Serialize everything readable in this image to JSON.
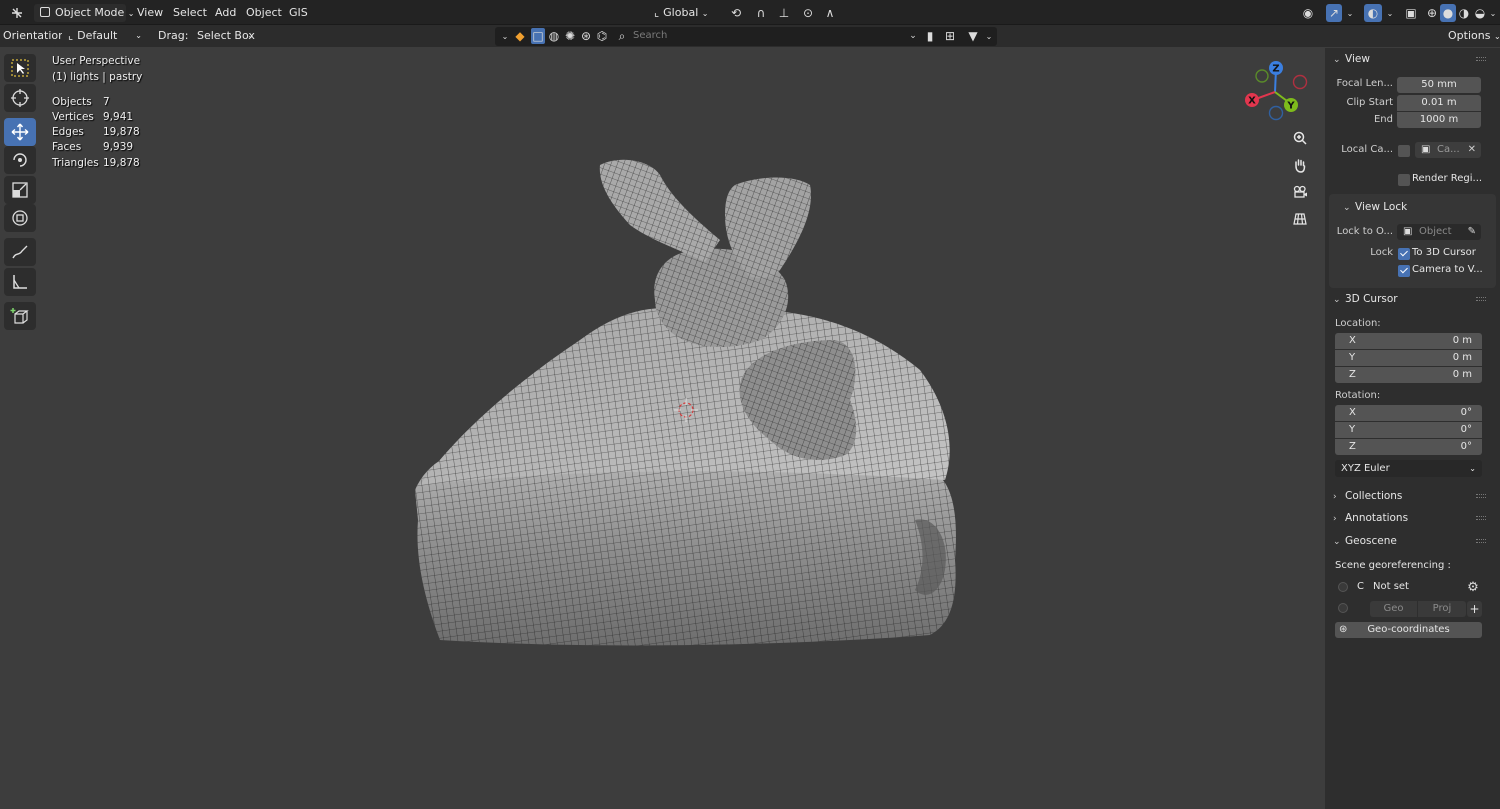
{
  "header": {
    "mode": "Object Mode",
    "menus": [
      "View",
      "Select",
      "Add",
      "Object",
      "GIS"
    ],
    "transform_orientation": "Global",
    "options_label": "Options"
  },
  "tool_settings": {
    "orientation_label": "Orientation:",
    "orientation_value": "Default",
    "drag_label": "Drag:",
    "drag_value": "Select Box",
    "search_placeholder": "Search"
  },
  "overlay": {
    "perspective": "User Perspective",
    "context": "(1) lights | pastry",
    "stats": [
      {
        "label": "Objects",
        "value": "7"
      },
      {
        "label": "Vertices",
        "value": "9,941"
      },
      {
        "label": "Edges",
        "value": "19,878"
      },
      {
        "label": "Faces",
        "value": "9,939"
      },
      {
        "label": "Triangles",
        "value": "19,878"
      }
    ]
  },
  "gizmo": {
    "x": "X",
    "y": "Y",
    "z": "Z"
  },
  "view_panel": {
    "title": "View",
    "focal_label": "Focal Len...",
    "focal_value": "50 mm",
    "clip_start_label": "Clip Start",
    "clip_start_value": "0.01 m",
    "end_label": "End",
    "end_value": "1000 m",
    "local_camera_label": "Local Ca...",
    "local_camera_value": "Ca...",
    "render_region_label": "Render Regi...",
    "view_lock_title": "View Lock",
    "lock_to_object_label": "Lock to O...",
    "lock_to_object_placeholder": "Object",
    "lock_label": "Lock",
    "to_cursor_label": "To 3D Cursor",
    "camera_to_view_label": "Camera to V..."
  },
  "cursor_panel": {
    "title": "3D Cursor",
    "location_label": "Location:",
    "location": [
      {
        "axis": "X",
        "value": "0 m"
      },
      {
        "axis": "Y",
        "value": "0 m"
      },
      {
        "axis": "Z",
        "value": "0 m"
      }
    ],
    "rotation_label": "Rotation:",
    "rotation": [
      {
        "axis": "X",
        "value": "0°"
      },
      {
        "axis": "Y",
        "value": "0°"
      },
      {
        "axis": "Z",
        "value": "0°"
      }
    ],
    "rotation_mode": "XYZ Euler"
  },
  "collections_title": "Collections",
  "annotations_title": "Annotations",
  "geoscene": {
    "title": "Geoscene",
    "georef_label": "Scene georeferencing :",
    "crs_letter": "C",
    "crs_value": "Not set",
    "geo_label": "Geo",
    "proj_label": "Proj",
    "geocoords_label": "Geo-coordinates"
  },
  "colors": {
    "accent": "#4772b3",
    "x_axis": "#e2364e",
    "y_axis": "#7ebb1c",
    "z_axis": "#3b7fe0",
    "viewport_bg": "#3d3d3d",
    "panel_bg": "#2e2e2e"
  }
}
